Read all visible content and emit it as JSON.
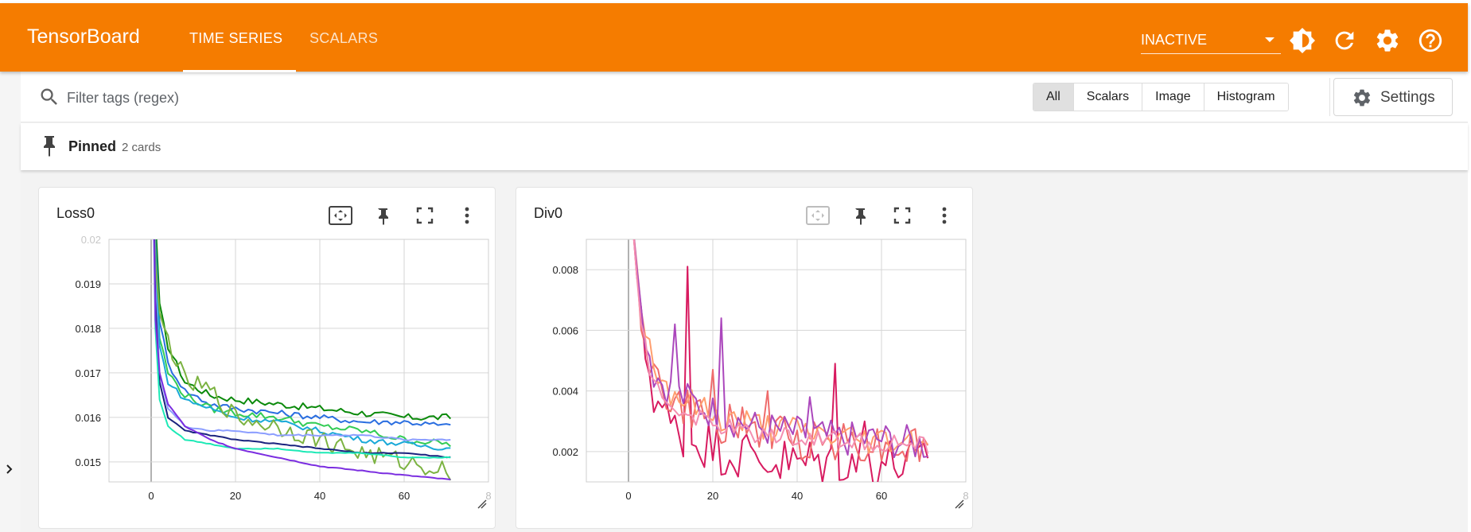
{
  "header": {
    "brand": "TensorBoard",
    "tabs": [
      {
        "label": "TIME SERIES",
        "active": true
      },
      {
        "label": "SCALARS",
        "active": false
      }
    ],
    "run_select": "INACTIVE",
    "icons": [
      "brightness-icon",
      "refresh-icon",
      "settings-gear-icon",
      "help-icon"
    ]
  },
  "filter": {
    "placeholder": "Filter tags (regex)",
    "types": [
      "All",
      "Scalars",
      "Image",
      "Histogram"
    ],
    "active_type": "All",
    "settings_label": "Settings"
  },
  "pinned": {
    "label": "Pinned",
    "count": "2 cards"
  },
  "colors": {
    "accent": "#f57c00"
  },
  "cards": [
    {
      "title": "Loss0",
      "fit_domain_enabled": true
    },
    {
      "title": "Div0",
      "fit_domain_enabled": false
    }
  ],
  "chart_data": [
    {
      "type": "line",
      "title": "Loss0",
      "xlim": [
        -10,
        80
      ],
      "ylim": [
        0.01455,
        0.02
      ],
      "x_ticks": [
        "0",
        "20",
        "40",
        "60",
        "8"
      ],
      "y_ticks": [
        "0.02",
        "0.019",
        "0.018",
        "0.017",
        "0.016",
        "0.015"
      ],
      "y_tick_values": [
        0.02,
        0.019,
        0.018,
        0.017,
        0.016,
        0.015
      ],
      "grid": true,
      "series": [
        {
          "color": "#0b8a0b",
          "noise": 8e-05,
          "values": [
            [
              0,
              0.024
            ],
            [
              1,
              0.0205
            ],
            [
              2,
              0.0185
            ],
            [
              4,
              0.0176
            ],
            [
              8,
              0.0168
            ],
            [
              14,
              0.0165
            ],
            [
              20,
              0.0164
            ],
            [
              30,
              0.0163
            ],
            [
              40,
              0.0162
            ],
            [
              50,
              0.0161
            ],
            [
              60,
              0.016
            ],
            [
              71,
              0.016
            ]
          ]
        },
        {
          "color": "#2a6ee0",
          "noise": 7e-05,
          "values": [
            [
              0,
              0.024
            ],
            [
              1,
              0.02
            ],
            [
              2,
              0.0182
            ],
            [
              4,
              0.0172
            ],
            [
              8,
              0.0166
            ],
            [
              14,
              0.0163
            ],
            [
              20,
              0.0162
            ],
            [
              30,
              0.0161
            ],
            [
              40,
              0.016
            ],
            [
              50,
              0.0159
            ],
            [
              60,
              0.0159
            ],
            [
              71,
              0.0158
            ]
          ]
        },
        {
          "color": "#33cc55",
          "noise": 8e-05,
          "values": [
            [
              0,
              0.024
            ],
            [
              1,
              0.0198
            ],
            [
              2,
              0.0178
            ],
            [
              4,
              0.017
            ],
            [
              8,
              0.0165
            ],
            [
              14,
              0.0162
            ],
            [
              20,
              0.0161
            ],
            [
              30,
              0.016
            ],
            [
              40,
              0.0158
            ],
            [
              50,
              0.0157
            ],
            [
              60,
              0.0155
            ],
            [
              71,
              0.0154
            ]
          ]
        },
        {
          "color": "#1aa9d8",
          "noise": 6e-05,
          "values": [
            [
              0,
              0.024
            ],
            [
              1,
              0.0196
            ],
            [
              2,
              0.0176
            ],
            [
              4,
              0.0168
            ],
            [
              8,
              0.0164
            ],
            [
              14,
              0.0162
            ],
            [
              20,
              0.016
            ],
            [
              30,
              0.0159
            ],
            [
              40,
              0.0157
            ],
            [
              50,
              0.0155
            ],
            [
              60,
              0.0154
            ],
            [
              71,
              0.0153
            ]
          ]
        },
        {
          "color": "#7cb342",
          "noise": 0.00022,
          "values": [
            [
              0,
              0.024
            ],
            [
              1,
              0.0195
            ],
            [
              2,
              0.0182
            ],
            [
              3,
              0.018
            ],
            [
              5,
              0.0175
            ],
            [
              8,
              0.0168
            ],
            [
              14,
              0.0166
            ],
            [
              20,
              0.016
            ],
            [
              30,
              0.0158
            ],
            [
              40,
              0.0155
            ],
            [
              50,
              0.0152
            ],
            [
              60,
              0.015
            ],
            [
              71,
              0.0148
            ]
          ]
        },
        {
          "color": "#8c9eff",
          "noise": 2e-05,
          "values": [
            [
              0,
              0.024
            ],
            [
              1,
              0.019
            ],
            [
              2,
              0.017
            ],
            [
              4,
              0.0162
            ],
            [
              8,
              0.0158
            ],
            [
              14,
              0.0157
            ],
            [
              20,
              0.0157
            ],
            [
              30,
              0.0156
            ],
            [
              40,
              0.0156
            ],
            [
              50,
              0.0156
            ],
            [
              60,
              0.0155
            ],
            [
              71,
              0.0155
            ]
          ]
        },
        {
          "color": "#1a237e",
          "noise": 1e-05,
          "values": [
            [
              0,
              0.024
            ],
            [
              1,
              0.0186
            ],
            [
              2,
              0.0168
            ],
            [
              4,
              0.016
            ],
            [
              8,
              0.0157
            ],
            [
              14,
              0.0156
            ],
            [
              20,
              0.0155
            ],
            [
              30,
              0.0154
            ],
            [
              40,
              0.0153
            ],
            [
              50,
              0.0152
            ],
            [
              60,
              0.0152
            ],
            [
              71,
              0.0151
            ]
          ]
        },
        {
          "color": "#1de9b6",
          "noise": 1e-05,
          "values": [
            [
              0,
              0.024
            ],
            [
              1,
              0.018
            ],
            [
              2,
              0.0164
            ],
            [
              4,
              0.0158
            ],
            [
              8,
              0.0155
            ],
            [
              14,
              0.0154
            ],
            [
              20,
              0.0153
            ],
            [
              30,
              0.0153
            ],
            [
              40,
              0.0152
            ],
            [
              50,
              0.0152
            ],
            [
              60,
              0.0151
            ],
            [
              71,
              0.0151
            ]
          ]
        },
        {
          "color": "#7b2ee0",
          "noise": 1e-05,
          "values": [
            [
              0,
              0.024
            ],
            [
              1,
              0.0182
            ],
            [
              2,
              0.017
            ],
            [
              4,
              0.0163
            ],
            [
              8,
              0.0158
            ],
            [
              14,
              0.0155
            ],
            [
              20,
              0.0153
            ],
            [
              30,
              0.0151
            ],
            [
              40,
              0.0149
            ],
            [
              50,
              0.0148
            ],
            [
              60,
              0.0147
            ],
            [
              71,
              0.0146
            ]
          ]
        }
      ]
    },
    {
      "type": "line",
      "title": "Div0",
      "xlim": [
        -10,
        80
      ],
      "ylim": [
        0.001,
        0.009
      ],
      "x_ticks": [
        "0",
        "20",
        "40",
        "60",
        "8"
      ],
      "y_ticks": [
        "0.008",
        "0.006",
        "0.004",
        "0.002"
      ],
      "y_tick_values": [
        0.008,
        0.006,
        0.004,
        0.002
      ],
      "grid": true,
      "series": [
        {
          "color": "#d81b60",
          "noise": 0.0009,
          "spikes": [
            [
              14,
              0.0081
            ],
            [
              49,
              0.0049
            ],
            [
              56,
              0.003
            ]
          ],
          "values": [
            [
              1,
              0.0095
            ],
            [
              3,
              0.006
            ],
            [
              6,
              0.004
            ],
            [
              10,
              0.0028
            ],
            [
              20,
              0.0022
            ],
            [
              30,
              0.0018
            ],
            [
              40,
              0.0016
            ],
            [
              50,
              0.0018
            ],
            [
              60,
              0.0017
            ],
            [
              71,
              0.0015
            ]
          ]
        },
        {
          "color": "#ef6c6c",
          "noise": 0.0007,
          "spikes": [
            [
              20,
              0.0047
            ],
            [
              33,
              0.004
            ]
          ],
          "values": [
            [
              1,
              0.0095
            ],
            [
              3,
              0.0065
            ],
            [
              6,
              0.0045
            ],
            [
              10,
              0.0036
            ],
            [
              20,
              0.003
            ],
            [
              30,
              0.0027
            ],
            [
              40,
              0.0024
            ],
            [
              50,
              0.0024
            ],
            [
              60,
              0.0022
            ],
            [
              71,
              0.0022
            ]
          ]
        },
        {
          "color": "#ff9e6e",
          "noise": 0.0005,
          "values": [
            [
              1,
              0.0095
            ],
            [
              3,
              0.0068
            ],
            [
              6,
              0.0048
            ],
            [
              10,
              0.004
            ],
            [
              20,
              0.0032
            ],
            [
              30,
              0.0029
            ],
            [
              40,
              0.0027
            ],
            [
              50,
              0.0025
            ],
            [
              60,
              0.0024
            ],
            [
              71,
              0.0024
            ]
          ]
        },
        {
          "color": "#ab47bc",
          "noise": 0.0006,
          "spikes": [
            [
              11,
              0.0062
            ],
            [
              22,
              0.0064
            ],
            [
              43,
              0.0038
            ]
          ],
          "values": [
            [
              1,
              0.0095
            ],
            [
              3,
              0.0066
            ],
            [
              6,
              0.0046
            ],
            [
              10,
              0.004
            ],
            [
              20,
              0.0033
            ],
            [
              30,
              0.0028
            ],
            [
              40,
              0.0026
            ],
            [
              50,
              0.0024
            ],
            [
              60,
              0.0024
            ],
            [
              71,
              0.0022
            ]
          ]
        },
        {
          "color": "#f48fb1",
          "noise": 0.0003,
          "values": [
            [
              1,
              0.0095
            ],
            [
              3,
              0.006
            ],
            [
              6,
              0.0042
            ],
            [
              10,
              0.0035
            ],
            [
              20,
              0.0029
            ],
            [
              30,
              0.0026
            ],
            [
              40,
              0.0025
            ],
            [
              50,
              0.0024
            ],
            [
              60,
              0.0023
            ],
            [
              71,
              0.0022
            ]
          ]
        }
      ]
    }
  ]
}
